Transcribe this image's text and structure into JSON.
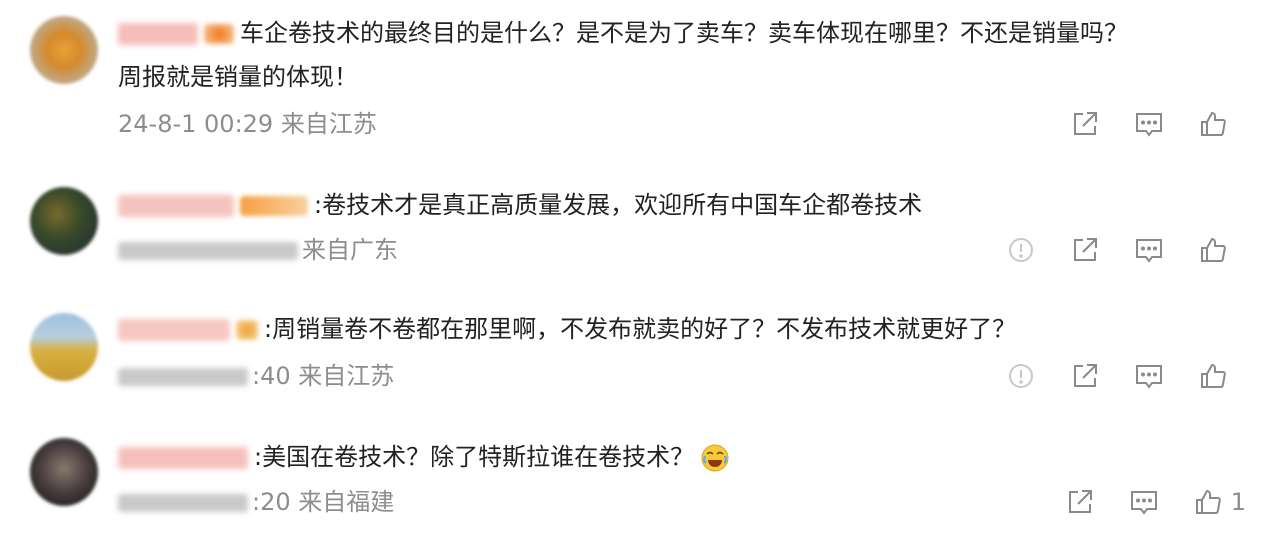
{
  "comments": [
    {
      "nickname_blurred": true,
      "line1": "车企卷技术的最终目的是什么？是不是为了卖车？卖车体现在哪里？不还是销量吗？",
      "line2": "周报就是销量的体现！",
      "time": "24-8-1 00:29",
      "location": "来自江苏",
      "likes": ""
    },
    {
      "nickname_blurred": true,
      "line1": ":卷技术才是真正高质量发展，欢迎所有中国车企都卷技术",
      "time": "",
      "location": "来自广东",
      "likes": ""
    },
    {
      "nickname_blurred": true,
      "line1": ":周销量卷不卷都在那里啊，不发布就卖的好了？不发布技术就更好了？",
      "time": ":40",
      "location": "来自江苏",
      "likes": ""
    },
    {
      "nickname_blurred": true,
      "line1": ":美国在卷技术？除了特斯拉谁在卷技术？",
      "time": ":20",
      "location": "来自福建",
      "likes": "1"
    }
  ],
  "icons": {
    "share": "share-icon",
    "comment": "comment-icon",
    "like": "thumbs-up-icon",
    "report": "report-icon",
    "emoji": "crying-laughing-emoji"
  },
  "colors": {
    "meta": "#8d8d8d",
    "icon": "#8a8a8a",
    "text": "#222222"
  }
}
